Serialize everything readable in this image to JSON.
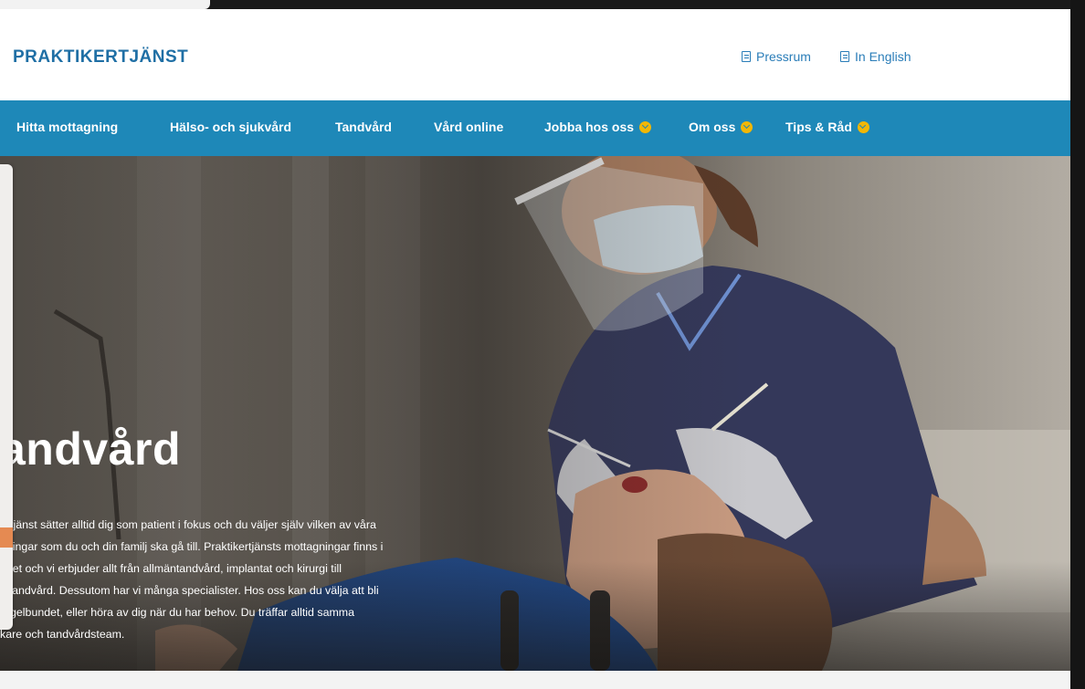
{
  "header": {
    "logo": "PRAKTIKERTJÄNST",
    "utility_links": [
      {
        "label": "Pressrum",
        "icon": "document-icon"
      },
      {
        "label": "In English",
        "icon": "document-icon"
      }
    ]
  },
  "nav": {
    "items": [
      {
        "label": "Hitta mottagning",
        "dropdown": false
      },
      {
        "label": "Hälso- och sjukvård",
        "dropdown": false
      },
      {
        "label": "Tandvård",
        "dropdown": false
      },
      {
        "label": "Vård online",
        "dropdown": false
      },
      {
        "label": "Jobba hos oss",
        "dropdown": true
      },
      {
        "label": "Om oss",
        "dropdown": true
      },
      {
        "label": "Tips & Råd",
        "dropdown": true
      }
    ]
  },
  "hero": {
    "title": "andvård",
    "lines": [
      "ertjänst sätter alltid dig som patient i fokus och du väljer själv vilken av våra",
      "gningar som du och din familj ska gå till. Praktikertjänsts mottagningar finns i",
      "ndet och vi erbjuder allt från allmäntandvård, implantat och kirurgi till",
      "k tandvård. Dessutom har vi många specialister. Hos oss kan du välja att bli",
      "regelbundet, eller höra av dig när du har behov. Du träffar alltid samma",
      "kare och tandvårdsteam."
    ]
  },
  "colors": {
    "brand_blue": "#1f6fa5",
    "nav_blue": "#1e88b8",
    "accent_yellow": "#f2b705"
  }
}
